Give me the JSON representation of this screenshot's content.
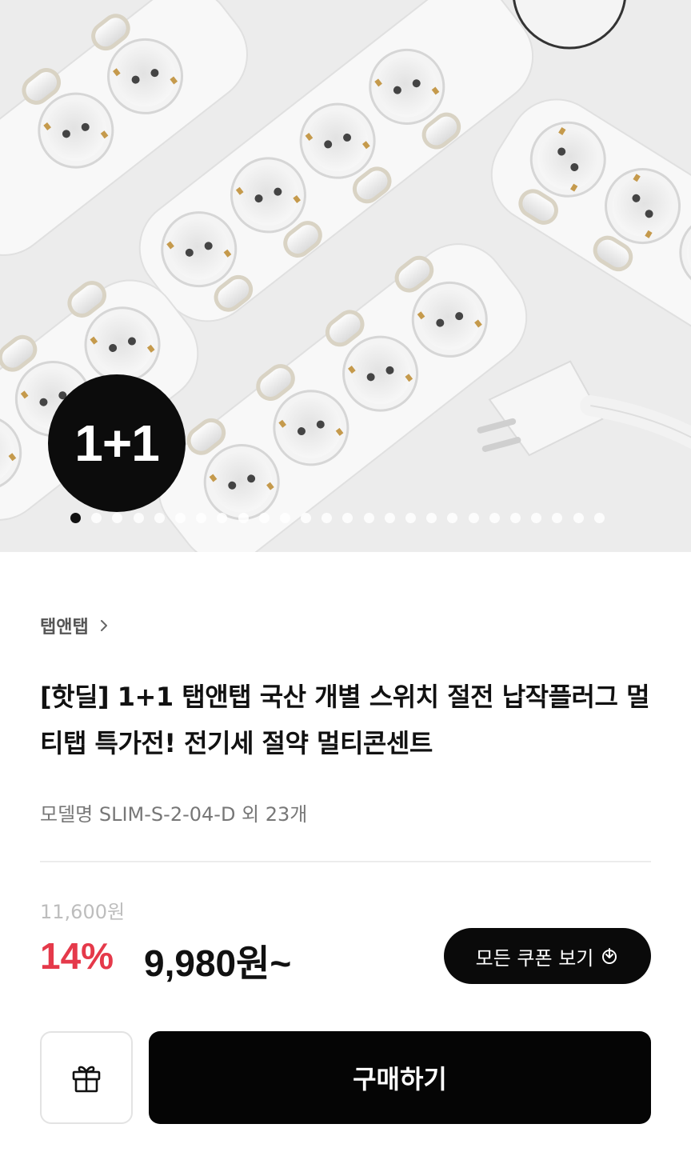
{
  "hero": {
    "badge_text": "1+1",
    "image_description_icon": "power-strip-product-photo",
    "carousel_dot_count": 26,
    "carousel_active_index": 0
  },
  "product": {
    "brand": "탭앤탭",
    "title": "[핫딜] 1+1 탭앤탭 국산 개별 스위치 절전 납작플러그 멀티탭 특가전! 전기세 절약 멀티콘센트",
    "model": "모델명 SLIM-S-2-04-D 외 23개"
  },
  "pricing": {
    "original_price": "11,600원",
    "discount": "14%",
    "price": "9,980원~",
    "discount_color": "#e5394a"
  },
  "actions": {
    "coupon_label": "모든 쿠폰 보기",
    "buy_label": "구매하기",
    "gift_icon": "gift-icon"
  }
}
